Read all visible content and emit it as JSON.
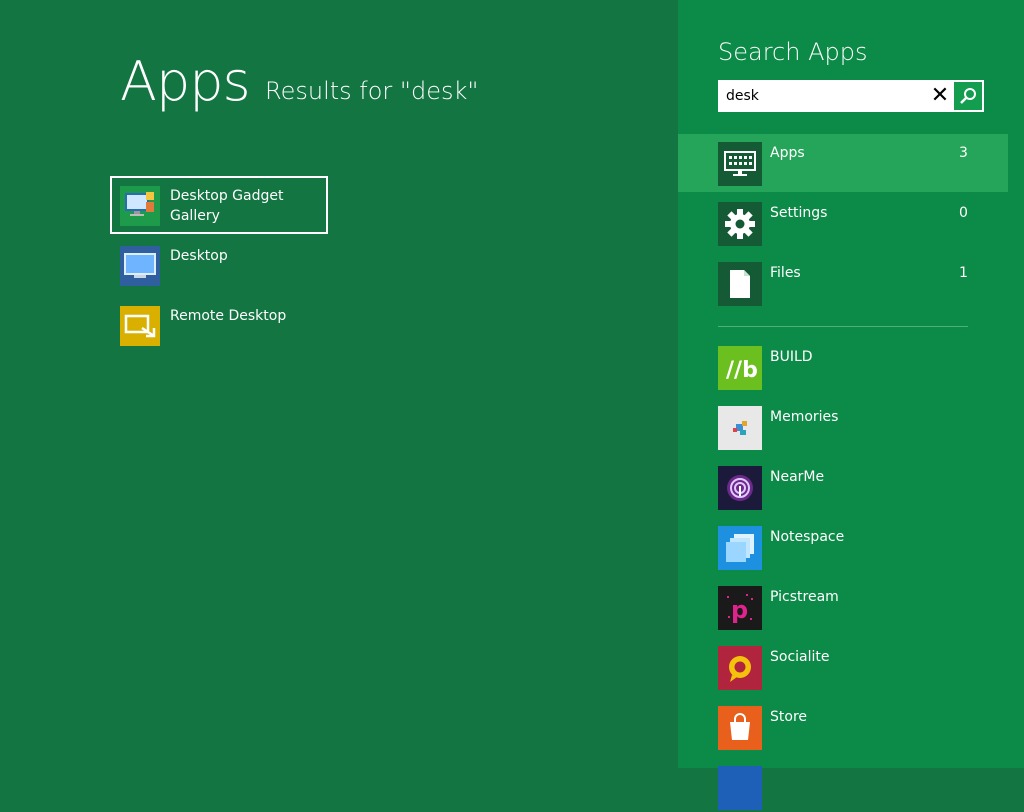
{
  "main": {
    "title": "Apps",
    "subtitle": "Results for \"desk\"",
    "results": [
      {
        "label": "Desktop Gadget Gallery",
        "icon": "gadget-gallery-icon",
        "tile_color": "#1e9a4b",
        "selected": true
      },
      {
        "label": "Desktop",
        "icon": "desktop-icon",
        "tile_color": "#2f5f9e",
        "selected": false
      },
      {
        "label": "Remote Desktop",
        "icon": "remote-desktop-icon",
        "tile_color": "#d9b000",
        "selected": false
      }
    ]
  },
  "search_pane": {
    "title": "Search Apps",
    "query": "desk",
    "clear_icon": "close-icon",
    "go_icon": "search-icon",
    "scopes": [
      {
        "label": "Apps",
        "count": "3",
        "icon": "keyboard-icon",
        "active": true
      },
      {
        "label": "Settings",
        "count": "0",
        "icon": "gear-icon",
        "active": false
      },
      {
        "label": "Files",
        "count": "1",
        "icon": "file-icon",
        "active": false
      }
    ],
    "apps": [
      {
        "label": "BUILD",
        "icon": "build-icon",
        "tile_color": "#6bbf1f"
      },
      {
        "label": "Memories",
        "icon": "memories-icon",
        "tile_color": "#e8e8e8"
      },
      {
        "label": "NearMe",
        "icon": "nearme-icon",
        "tile_color": "#1b1a3a"
      },
      {
        "label": "Notespace",
        "icon": "notespace-icon",
        "tile_color": "#1e90e0"
      },
      {
        "label": "Picstream",
        "icon": "picstream-icon",
        "tile_color": "#1a1a1a"
      },
      {
        "label": "Socialite",
        "icon": "socialite-icon",
        "tile_color": "#b0243e"
      },
      {
        "label": "Store",
        "icon": "store-icon",
        "tile_color": "#e8601c"
      }
    ]
  },
  "colors": {
    "background": "#137542",
    "pane": "#0c8a47",
    "active_scope": "#24a559"
  }
}
